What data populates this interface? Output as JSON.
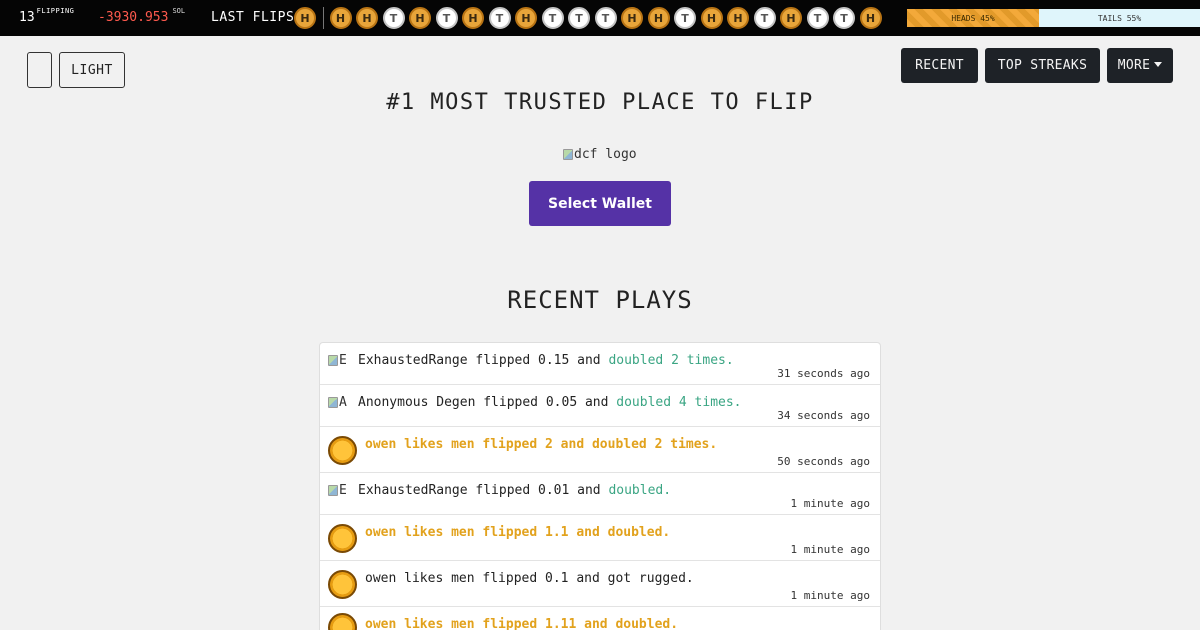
{
  "ticker": {
    "flipping_count": "13",
    "flipping_label": "FLIPPING",
    "pnl_value": "-3930.953",
    "pnl_unit": "SOL",
    "last_flips_label": "LAST FLIPS",
    "first_coin": "H",
    "coins": [
      "H",
      "H",
      "T",
      "H",
      "T",
      "H",
      "T",
      "H",
      "T",
      "T",
      "T",
      "H",
      "H",
      "T",
      "H",
      "H",
      "T",
      "H",
      "T",
      "T",
      "H"
    ],
    "heads_label": "HEADS 45%",
    "tails_label": "TAILS 55%",
    "heads_fraction": 0.45,
    "colors": {
      "heads": "#f3a93a",
      "tails": "#dff5fb",
      "loss": "#ff5a4e"
    }
  },
  "header": {
    "theme_button_label": "LIGHT",
    "nav": {
      "recent": "RECENT",
      "top_streaks": "TOP STREAKS",
      "more": "MORE"
    }
  },
  "hero": {
    "headline": "#1 MOST TRUSTED PLACE TO FLIP",
    "logo_alt": "dcf logo",
    "select_wallet_label": "Select Wallet",
    "accent_color": "#5532a6"
  },
  "recent_plays": {
    "title": "RECENT PLAYS",
    "rows": [
      {
        "avatar": "broken",
        "avatar_alt": "E",
        "text": "ExhaustedRange flipped 0.15 and ",
        "result": "doubled 2 times.",
        "time": "31 seconds ago",
        "highlight": false
      },
      {
        "avatar": "broken",
        "avatar_alt": "A",
        "text": "Anonymous Degen flipped 0.05 and ",
        "result": "doubled 4 times.",
        "time": "34 seconds ago",
        "highlight": false
      },
      {
        "avatar": "coin",
        "avatar_alt": "",
        "text": "owen likes men flipped 2 and doubled 2 times.",
        "result": "",
        "time": "50 seconds ago",
        "highlight": true
      },
      {
        "avatar": "broken",
        "avatar_alt": "E",
        "text": "ExhaustedRange flipped 0.01 and ",
        "result": "doubled.",
        "time": "1 minute ago",
        "highlight": false
      },
      {
        "avatar": "coin",
        "avatar_alt": "",
        "text": "owen likes men flipped 1.1 and doubled.",
        "result": "",
        "time": "1 minute ago",
        "highlight": true
      },
      {
        "avatar": "coin",
        "avatar_alt": "",
        "text": "owen likes men flipped 0.1 and got rugged.",
        "result": "",
        "time": "1 minute ago",
        "highlight": false
      },
      {
        "avatar": "coin",
        "avatar_alt": "",
        "text": "owen likes men flipped 1.11 and doubled.",
        "result": "",
        "time": "",
        "highlight": true
      }
    ]
  }
}
